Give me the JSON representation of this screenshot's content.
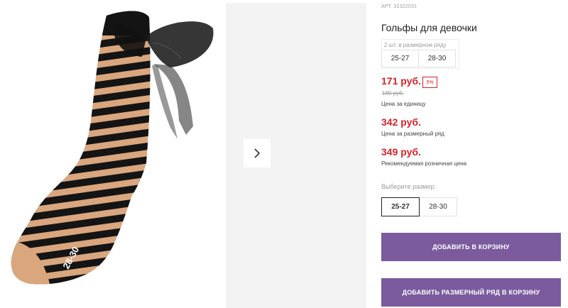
{
  "gallery": {
    "sock_size_print": "28-30",
    "next_icon": "chevron-right-icon"
  },
  "product": {
    "sku": "АРТ. 32322031",
    "title": "Гольфы для девочки",
    "set_label": "2 шт. в размерном ряду",
    "set_sizes": [
      "25-27",
      "28-30"
    ],
    "price": "171 руб.",
    "discount": "5%",
    "old_price": "180 руб.",
    "unit_label": "Цена за единицу",
    "set_price": "342 руб.",
    "set_price_label": "Цена за размерный ряд",
    "retail_price": "349 руб.",
    "retail_label": "Рекомендуемая розничная цена",
    "choose_label": "Выберите размер:",
    "size_options": [
      "25-27",
      "28-30"
    ],
    "selected_size": "25-27",
    "add_to_cart": "Добавить в корзину",
    "add_set_to_cart": "Добавить размерный ряд в корзину"
  },
  "colors": {
    "price_red": "#d2232a",
    "button_purple": "#7b5b9d",
    "stripe_black": "#141414",
    "stripe_tan": "#d9a67e"
  }
}
